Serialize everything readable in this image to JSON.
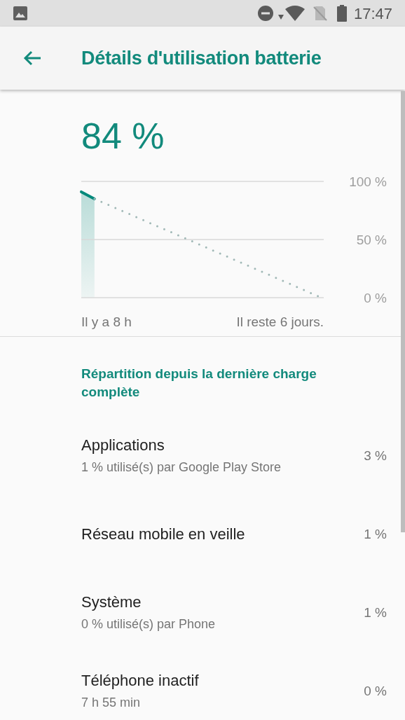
{
  "status_bar": {
    "time": "17:47"
  },
  "toolbar": {
    "title": "Détails d'utilisation batterie"
  },
  "battery": {
    "percentage": "84 %",
    "chart_data": {
      "type": "line",
      "ylim": [
        0,
        100
      ],
      "yticks": [
        {
          "value": 100,
          "label": "100 %"
        },
        {
          "value": 50,
          "label": "50 %"
        },
        {
          "value": 0,
          "label": "0 %"
        }
      ],
      "categories": [
        null,
        null,
        null,
        null,
        null,
        null,
        null,
        null,
        null,
        null,
        null,
        null,
        null,
        null,
        null,
        null,
        null,
        null,
        null
      ],
      "series": [
        {
          "color": "#00897b",
          "values": [
            91,
            85,
            null,
            null,
            null,
            null,
            null,
            null,
            null,
            null,
            null,
            null,
            null,
            null,
            null,
            null,
            null,
            null,
            null
          ]
        },
        {
          "color": "#a0b8b6",
          "line_style": "dotted",
          "values": [
            null,
            85,
            80.1,
            75.1,
            70.2,
            65.2,
            60.3,
            55.4,
            50.4,
            45.5,
            40.5,
            35.6,
            30.6,
            25.7,
            20.8,
            15.8,
            10.9,
            5.9,
            1
          ]
        }
      ]
    },
    "x_start_label": "Il y a 8 h",
    "x_end_label": "Il reste 6 jours."
  },
  "section": {
    "header": "Répartition depuis la dernière charge complète",
    "items": [
      {
        "title": "Applications",
        "summary": "1 % utilisé(s) par Google Play Store",
        "value": "3 %"
      },
      {
        "title": "Réseau mobile en veille",
        "value": "1 %"
      },
      {
        "title": "Système",
        "summary": "0 % utilisé(s) par Phone",
        "value": "1 %"
      },
      {
        "title": "Téléphone inactif",
        "summary": "7 h 55 min",
        "value": "0 %"
      }
    ]
  }
}
